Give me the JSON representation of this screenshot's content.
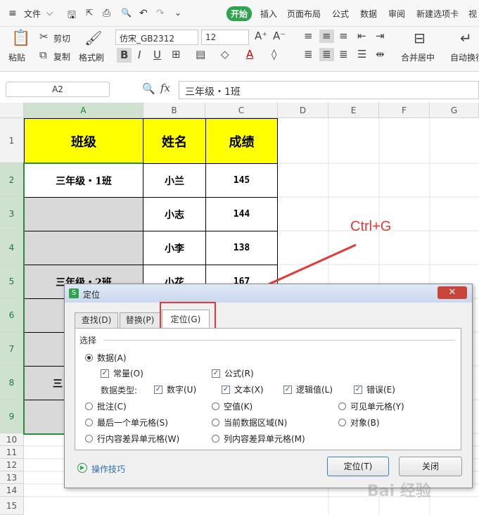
{
  "menubar": {
    "file": "文件",
    "tabs": [
      "开始",
      "插入",
      "页面布局",
      "公式",
      "数据",
      "审阅",
      "新建选项卡",
      "视"
    ]
  },
  "ribbon": {
    "paste": "粘贴",
    "cut": "剪切",
    "copy": "复制",
    "format_painter": "格式刷",
    "font_name": "仿宋_GB2312",
    "font_size": "12",
    "merge_center": "合并居中",
    "wrap": "自动换行"
  },
  "formula_bar": {
    "cell_ref": "A2",
    "fx": "fx",
    "content": "三年级・1班"
  },
  "sheet": {
    "columns": [
      "A",
      "B",
      "C",
      "D",
      "E",
      "F",
      "G"
    ],
    "rows": [
      "1",
      "2",
      "3",
      "4",
      "5",
      "6",
      "7",
      "8",
      "9",
      "10",
      "11",
      "12",
      "13",
      "14",
      "15"
    ],
    "header": {
      "a": "班级",
      "b": "姓名",
      "c": "成绩"
    },
    "r2": {
      "a": "三年级・1班",
      "b": "小兰",
      "c": "145"
    },
    "r3": {
      "b": "小志",
      "c": "144"
    },
    "r4": {
      "b": "小李",
      "c": "138"
    },
    "r5": {
      "a": "三年级・2班",
      "b": "小花",
      "c": "167"
    },
    "r8": {
      "a": "三"
    }
  },
  "annotation": {
    "text": "Ctrl+G",
    "color": "#e53935"
  },
  "dialog": {
    "title": "定位",
    "tabs": [
      "查找(D)",
      "替换(P)",
      "定位(G)"
    ],
    "group": "选择",
    "data": "数据(A)",
    "constants": "常量(O)",
    "formulas": "公式(R)",
    "datatype_label": "数据类型:",
    "numbers": "数字(U)",
    "text": "文本(X)",
    "logical": "逻辑值(L)",
    "errors": "错误(E)",
    "comments": "批注(C)",
    "blanks": "空值(K)",
    "visible": "可见单元格(Y)",
    "last_cell": "最后一个单元格(S)",
    "current_region": "当前数据区域(N)",
    "objects": "对象(B)",
    "row_diff": "行内容差异单元格(W)",
    "col_diff": "列内容差异单元格(M)",
    "tips": "操作技巧",
    "ok": "定位(T)",
    "close": "关闭"
  },
  "watermark": "Bai 经验"
}
